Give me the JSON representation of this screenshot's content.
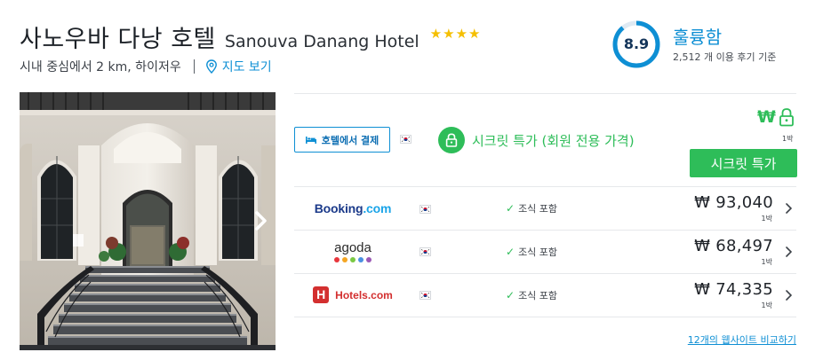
{
  "hotel": {
    "name_ko": "사노우바 다낭 호텔",
    "name_en": "Sanouva Danang Hotel",
    "star_count": 4,
    "location": "시내 중심에서 2 km, 하이저우",
    "map_link": "지도 보기"
  },
  "rating": {
    "score": "8.9",
    "score_fraction": 0.89,
    "label": "훌륭함",
    "reviews": "2,512 개 이용 후기 기준"
  },
  "pay_at_hotel": {
    "label": "호텔에서 결제"
  },
  "secret_deal": {
    "text": "시크릿 특가 (회원 전용 가격)",
    "currency": "₩",
    "per_night": "1박",
    "button_label": "시크릿 특가"
  },
  "deals": [
    {
      "provider": "Booking.com",
      "logo_main": "Booking",
      "logo_suffix": ".com",
      "breakfast": "조식 포함",
      "price": "₩ 93,040",
      "per_night": "1박"
    },
    {
      "provider": "agoda",
      "logo_main": "agoda",
      "breakfast": "조식 포함",
      "price": "₩ 68,497",
      "per_night": "1박"
    },
    {
      "provider": "Hotels.com",
      "logo_badge": "H",
      "logo_main": "Hotels.com",
      "breakfast": "조식 포함",
      "price": "₩ 74,335",
      "per_night": "1박"
    }
  ],
  "compare_link": "12개의 웹사이트 비교하기",
  "colors": {
    "accent_blue": "#0e8fd4",
    "secret_green": "#2ebd59",
    "star_yellow": "#f5bf00",
    "hotels_red": "#d32f2f",
    "booking_navy": "#1b3a8a",
    "agoda_dots": [
      "#e8363c",
      "#f5a623",
      "#7ac943",
      "#4a90e2",
      "#9b59b6"
    ]
  },
  "icons": [
    "star-icon",
    "map-pin-icon",
    "chevron-right-icon",
    "bed-icon",
    "lock-icon",
    "check-icon",
    "korea-flag-icon"
  ]
}
